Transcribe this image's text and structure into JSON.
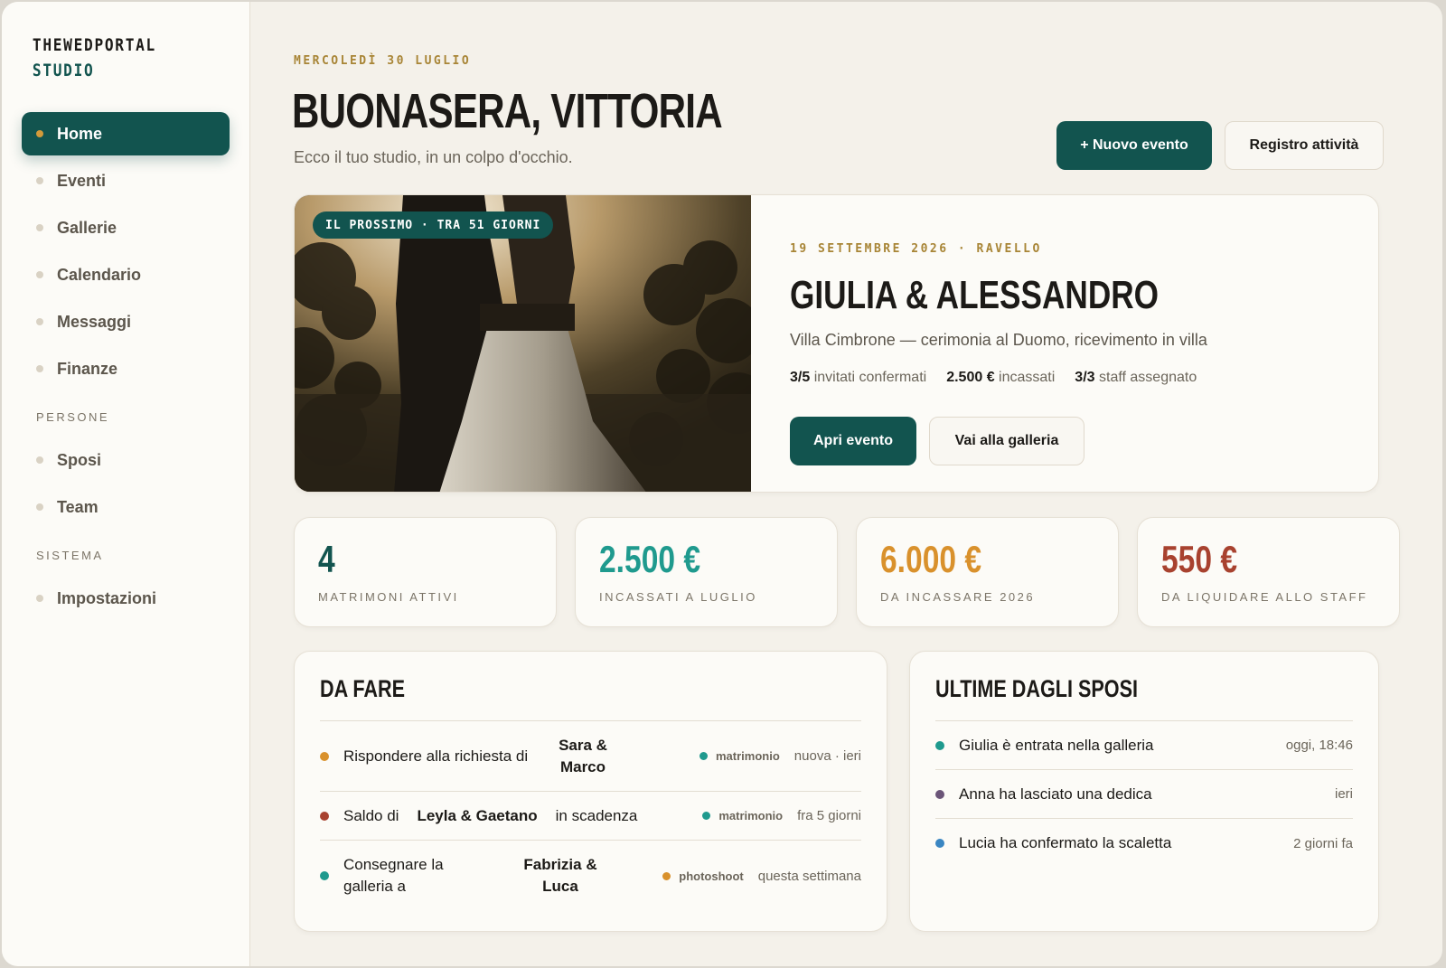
{
  "brand": {
    "line1": "THEWEDPORTAL",
    "line2": "STUDIO"
  },
  "sidebar": {
    "nav": [
      {
        "label": "Home",
        "active": true
      },
      {
        "label": "Eventi"
      },
      {
        "label": "Gallerie"
      },
      {
        "label": "Calendario"
      },
      {
        "label": "Messaggi"
      },
      {
        "label": "Finanze"
      }
    ],
    "people_title": "PERSONE",
    "people": [
      {
        "label": "Sposi"
      },
      {
        "label": "Team"
      }
    ],
    "system_title": "SISTEMA",
    "system": [
      {
        "label": "Impostazioni"
      }
    ]
  },
  "header": {
    "date": "MERCOLEDÌ 30 LUGLIO",
    "greeting": "BUONASERA, VITTORIA",
    "subtitle": "Ecco il tuo studio, in un colpo d'occhio.",
    "new_event_label": "+ Nuovo evento",
    "activity_log_label": "Registro attività"
  },
  "hero": {
    "badge": "IL PROSSIMO · TRA 51 GIORNI",
    "date_place": "19 SETTEMBRE 2026 · RAVELLO",
    "title": "GIULIA & ALESSANDRO",
    "place": "Villa Cimbrone — cerimonia al Duomo, ricevimento in villa",
    "stats": [
      {
        "value": "3/5",
        "label": "invitati confermati"
      },
      {
        "value": "2.500 €",
        "label": "incassati"
      },
      {
        "value": "3/3",
        "label": "staff assegnato"
      }
    ],
    "open_label": "Apri evento",
    "gallery_label": "Vai alla galleria"
  },
  "stats": [
    {
      "value": "4",
      "label": "MATRIMONI ATTIVI",
      "color": "#12544f"
    },
    {
      "value": "2.500 €",
      "label": "INCASSATI A LUGLIO",
      "color": "#1f9a8e"
    },
    {
      "value": "6.000 €",
      "label": "DA INCASSARE 2026",
      "color": "#d9912c"
    },
    {
      "value": "550 €",
      "label": "DA LIQUIDARE ALLO STAFF",
      "color": "#a8422f"
    }
  ],
  "todo": {
    "title": "DA FARE",
    "items": [
      {
        "text": "Rispondere alla richiesta di",
        "name": "Sara & Marco",
        "tail": "",
        "tag": "matrimonio",
        "tag_color": "#1f9a8e",
        "dot_color": "#d9912c",
        "when": "nuova · ieri"
      },
      {
        "text": "Saldo di",
        "name": "Leyla & Gaetano",
        "tail": "in scadenza",
        "tag": "matrimonio",
        "tag_color": "#1f9a8e",
        "dot_color": "#a8422f",
        "when": "fra 5 giorni"
      },
      {
        "text": "Consegnare la galleria a",
        "name": "Fabrizia & Luca",
        "tail": "",
        "tag": "photoshoot",
        "tag_color": "#d9912c",
        "dot_color": "#1f9a8e",
        "when": "questa settimana"
      }
    ]
  },
  "news": {
    "title": "ULTIME DAGLI SPOSI",
    "items": [
      {
        "text": "Giulia è entrata nella galleria",
        "when": "oggi, 18:46",
        "dot_color": "#1f9a8e"
      },
      {
        "text": "Anna ha lasciato una dedica",
        "when": "ieri",
        "dot_color": "#6b5578"
      },
      {
        "text": "Lucia ha confermato la scaletta",
        "when": "2 giorni fa",
        "dot_color": "#3a86c2"
      }
    ]
  },
  "colors": {
    "accent": "#12544f",
    "gold": "#a88536",
    "background": "#f4f1ea"
  }
}
